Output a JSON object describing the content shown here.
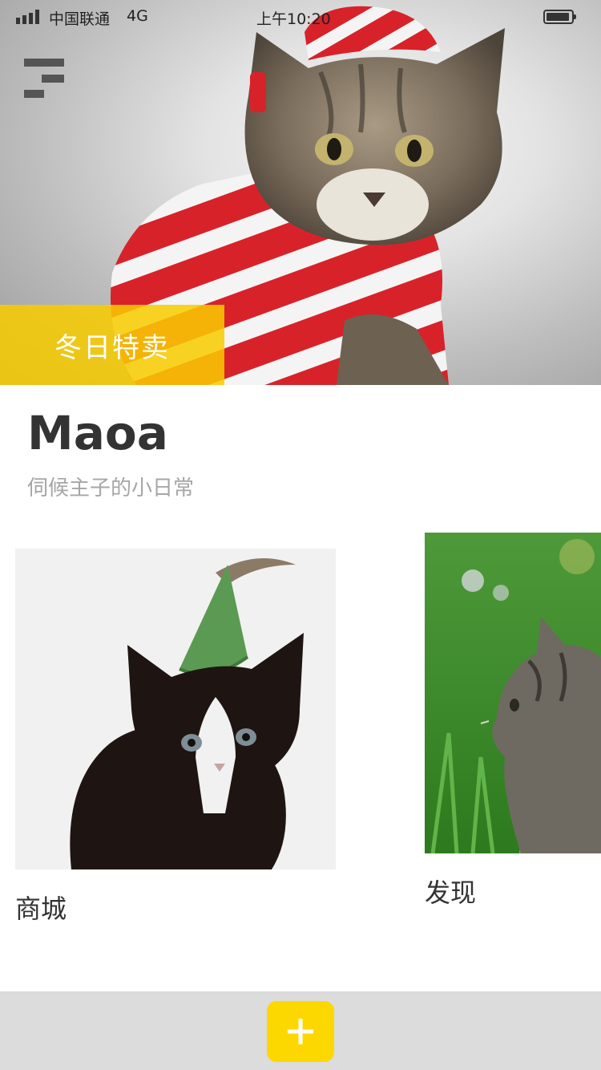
{
  "status_bar": {
    "carrier": "中国联通",
    "network": "4G",
    "time": "上午10:20"
  },
  "hero": {
    "promo_label": "冬日特卖"
  },
  "brand": {
    "title": "Maoa",
    "subtitle": "伺候主子的小日常"
  },
  "cards": [
    {
      "label": "商城"
    },
    {
      "label": "发现"
    }
  ],
  "bottom_bar": {
    "add_icon": "plus-icon"
  },
  "colors": {
    "accent_yellow": "#fcd800",
    "promo_yellow": "#f8cc00",
    "text_dark": "#333333",
    "text_muted": "#a6a6a6",
    "bottom_bar_bg": "#dcdcdc"
  }
}
